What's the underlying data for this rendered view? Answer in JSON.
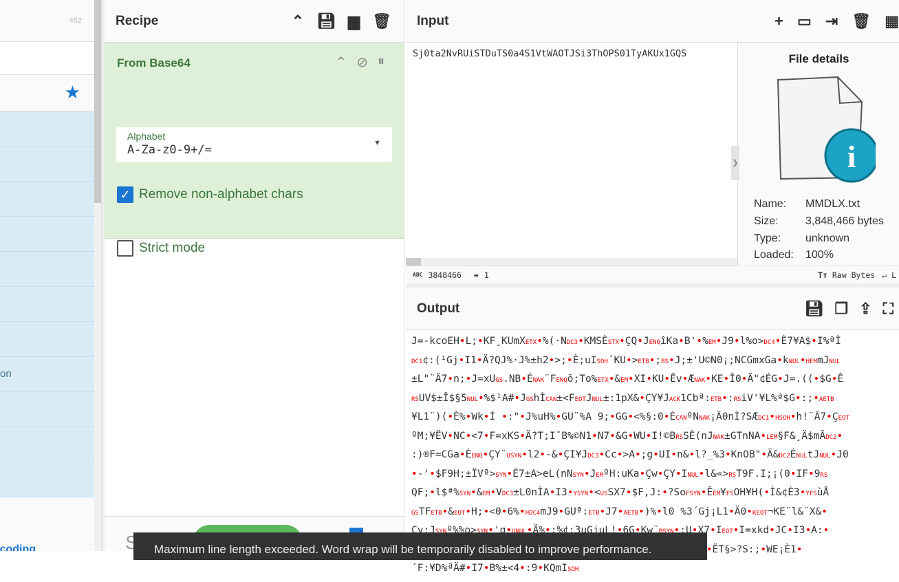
{
  "operations": {
    "count": "452",
    "favourites_icon": "star-icon",
    "visible_item_fragment": "on",
    "category_fragment": "coding"
  },
  "recipe": {
    "title": "Recipe",
    "icons": [
      "chevron-up-icon",
      "save-icon",
      "folder-icon",
      "trash-icon"
    ],
    "operation": {
      "name": "From Base64",
      "alphabet_label": "Alphabet",
      "alphabet_value": "A-Za-z0-9+/=",
      "remove_non_alphabet": {
        "label": "Remove non-alphabet chars",
        "checked": true
      },
      "strict_mode": {
        "label": "Strict mode",
        "checked": false
      }
    },
    "step_fragment": "S"
  },
  "input": {
    "title": "Input",
    "text": "Sj0ta2NvRUiSTDuTS0a4S1VtWAOTJSi3ThOPS01TyAKUx1GQS",
    "file_details": {
      "title": "File details",
      "name_label": "Name:",
      "name": "MMDLX.txt",
      "size_label": "Size:",
      "size": "3,848,466 bytes",
      "type_label": "Type:",
      "type": "unknown",
      "loaded_label": "Loaded:",
      "loaded": "100%",
      "loaded_fraction": 1.0
    },
    "status": {
      "length": "3848466",
      "lines": "1",
      "format": "Raw Bytes",
      "eol_fragment": "L"
    }
  },
  "output": {
    "title": "Output",
    "lines": [
      "J=-kcoEH•L;•KF¸KUmXETX•%(·NDC3•KMSÈSTX•ÇQ•JENQîKa•B'•%EM•J9•l%o>DC4•È7¥A$•I%ªÌ",
      "DC1¢:(¹Gj•I1•Ä?QJ%·J%±h2•>;•È;uISOH´KU•>ETB•;BS•J;±'U©N0¡;NCGmxGa•kNUL•HEMmJNUL",
      "±L\"¨Ä7•n;•J=xUGS.NB•ÉNAK¨FENQõ;To%ETX•&EM•XI•KU•Ëv•ÆNAK•KE•Î0•Ä\"¢ÉG•J=.((•$G•Ê",
      "RSUV$±Î$§5NUL•%$¹A#•JGShÌCAN±<FEOTJNUL±:1pX&•ÇY¥JACK1Cbª:ETB•:RSiV'¥L%ª$G•:;•AETB",
      "¥L1¨)(•È%•Wk•Í •:\"•J%uH%•GU¨%A 9;•GG•<%§:0•ÉCANºNNAK¡Ä0nÌ?SÆDC1•HSOH•h!¨Ä7•ÇEOT",
      "ºM;¥ËV•NC•<7•F=xKS•Ä?T;I¯B%©N1•N7•&G•WU•I!©BRSSÈ(nJNAK±GTnNA•LEM§F&¸Ä$mÄDC2•",
      ":)®F=CGa•ÈENQ•ÇY¨USYN•l2•-&•ÇI¥JDC3•Cc•>A•;g•UI•n&•l?_%3•KnOB\"•Ä&DC2ÉNULtJNUL•J0",
      "•-'•$F9H;±ÏVª>SYN•É7±A>eL(nNSYN•JEMºH:uKa•Çw•ÇY•INUL•l&«>RST9F.I;¡(0•IF•9RS",
      "QF;•l$ª%SYN•&EM•VDC3±L0nÌA•I3•YSYN•<USSX7•$F,J:•?SoFSYN•ÊEM¥FSOH¥H(•Ì&¢È3•YFSùÅ",
      "GSTFETB•&EOT•H;•<0•6%•HDC4mJ9•GUª:ETB•J7•AETB•)%•l0 %3´Gj¡L1•Ä0•KEOT¬KE¨l&¨X&•",
      "Çv:JSYNº%%o>SYN•'g•UNUL•Ä%•:%¢:3µGjuL!•6G•Kw¨BSYN•;U•X7•IEOT•I=xkd•JC•I3•A:•",
      "KX¨F0•;D¸WG•N%•FSYN±I3•GDyKY•Ä7•<DC1¶J=tGRnEH•Çc•V:•ËT§>?S:;•WE¡È1•",
      "´F:¥D%ªÄ#•I7•B%±<4•:9•KQmISOH"
    ],
    "icons": [
      "save-icon",
      "copy-icon",
      "replace-input-icon",
      "maximise-icon"
    ]
  },
  "toast": {
    "message": "Maximum line length exceeded. Word wrap will be temporarily disabled to improve performance."
  },
  "colors": {
    "recipe_op_bg": "#dff0d8",
    "recipe_op_text": "#3c763d",
    "accent": "#1976d2",
    "bake": "#5cb85c",
    "control_char": "#e00000"
  }
}
